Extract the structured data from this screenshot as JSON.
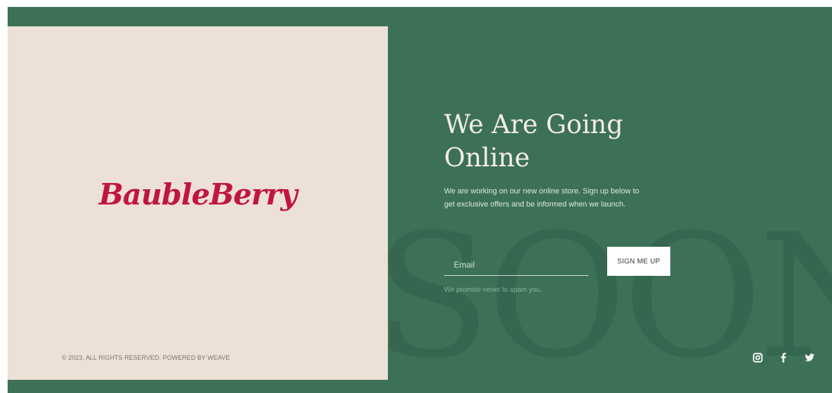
{
  "brand": {
    "logo_text": "BaubleBerry",
    "logo_color": "#c0163e"
  },
  "hero": {
    "heading": "We Are Going Online",
    "description": "We are working on our new online store. Sign up below to get exclusive offers and be informed when we launch.",
    "background_word": "SOON"
  },
  "form": {
    "email_placeholder": "Email",
    "email_value": "",
    "submit_label": "SIGN ME UP",
    "note": "We promise never to spam you."
  },
  "footer": {
    "copyright": "© 2023, ALL RIGHTS RESERVED. POWERED BY WEAVE"
  },
  "social": [
    {
      "icon": "instagram-icon"
    },
    {
      "icon": "facebook-icon"
    },
    {
      "icon": "twitter-icon"
    }
  ],
  "colors": {
    "primary_green": "#3d7157",
    "panel_beige": "#ede0d7",
    "heading_text": "#f3ece5"
  }
}
